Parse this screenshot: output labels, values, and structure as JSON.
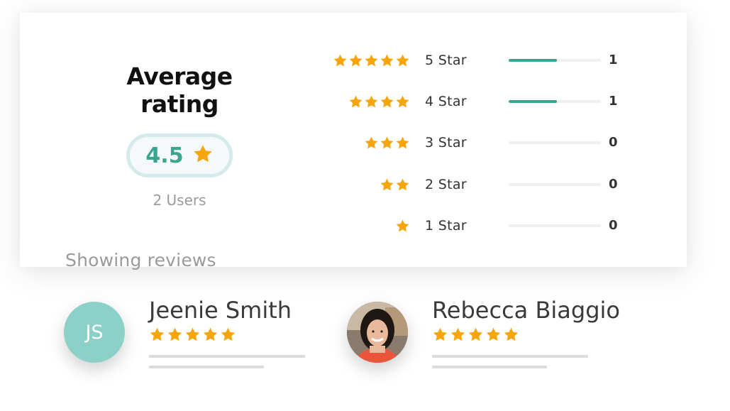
{
  "summary": {
    "title": "Average rating",
    "score": "4.5",
    "users": "2 Users"
  },
  "breakdown": [
    {
      "stars": 5,
      "label": "5 Star",
      "count": "1",
      "fill": 0.52
    },
    {
      "stars": 4,
      "label": "4 Star",
      "count": "1",
      "fill": 0.52
    },
    {
      "stars": 3,
      "label": "3 Star",
      "count": "0",
      "fill": 0
    },
    {
      "stars": 2,
      "label": "2 Star",
      "count": "0",
      "fill": 0
    },
    {
      "stars": 1,
      "label": "1 Star",
      "count": "0",
      "fill": 0
    }
  ],
  "reviews_heading": "Showing reviews",
  "reviews": [
    {
      "name": "Jeenie Smith",
      "initials": "JS",
      "avatar_color": "#8dd0c7",
      "stars": 5
    },
    {
      "name": "Rebecca Biaggio",
      "initials": "",
      "avatar": "photo",
      "stars": 5
    }
  ],
  "colors": {
    "star": "#f6a60d",
    "accent": "#3aa68d",
    "pill_border": "#d5eaeb",
    "muted_text": "#9a9a9a"
  },
  "icons": {
    "star": "star-icon"
  }
}
